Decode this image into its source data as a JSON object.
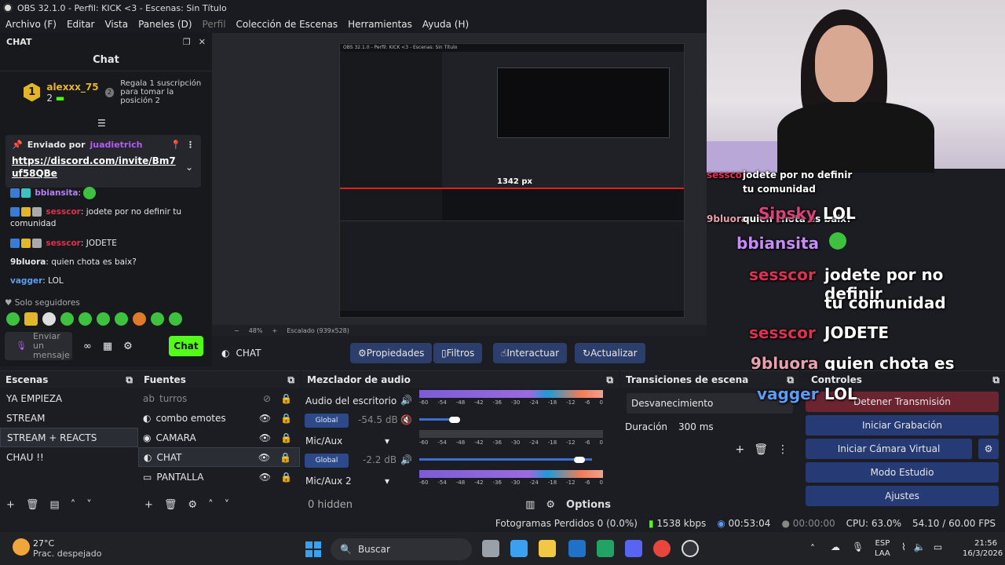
{
  "window": {
    "title": "OBS 32.1.0 - Perfil: KICK <3 - Escenas: Sin Título"
  },
  "menu": [
    "Archivo (F)",
    "Editar",
    "Vista",
    "Paneles (D)",
    "Perfil",
    "Colección de Escenas",
    "Herramientas",
    "Ayuda (H)"
  ],
  "chat_dock": {
    "dock_title": "CHAT",
    "header": "Chat",
    "gift": {
      "rank": "1",
      "user": "alexxx_75",
      "count": "2",
      "position": "2",
      "text": "Regala 1 suscripción para tomar la posición 2"
    },
    "pinned": {
      "label": "Enviado por",
      "user": "juadietrich",
      "link": "https://discord.com/invite/Bm7uf58QBe"
    },
    "messages": [
      {
        "user": "bbiansita",
        "sep": ":",
        "text": "",
        "color": "#b97ff7"
      },
      {
        "user": "sesscor",
        "sep": ":",
        "text": " jodete por no definir tu comunidad",
        "color": "#e0304f"
      },
      {
        "user": "sesscor",
        "sep": ":",
        "text": " JODETE",
        "color": "#e0304f"
      },
      {
        "user": "9bluora",
        "sep": ":",
        "text": " quien chota es baix?",
        "color": "#e6e6e6"
      },
      {
        "user": "vagger",
        "sep": ":",
        "text": " LOL",
        "color": "#5c9cf5"
      }
    ],
    "follow_only": "Solo seguidores",
    "input_placeholder": "Enviar un mensaje",
    "send_button": "Chat"
  },
  "preview": {
    "scale_info": "48%",
    "scale_label": "Escalado (939x528)",
    "mini_px": "1342 px"
  },
  "source_toolbar": {
    "source": "CHAT",
    "buttons": [
      "Propiedades",
      "Filtros",
      "Interactuar",
      "Actualizar"
    ]
  },
  "overlay_chat": [
    {
      "user": "sesscor",
      "text": "jodete por no definir"
    },
    {
      "user": "",
      "text": "tu comunidad"
    },
    {
      "user": "9bluora",
      "text": "quien chota es baix?"
    },
    {
      "user": "Sipsky",
      "text": "LOL"
    },
    {
      "user": "bbiansita",
      "text": ""
    },
    {
      "user": "sesscor",
      "text": "jodete por no definir"
    },
    {
      "user": "",
      "text": "tu comunidad"
    },
    {
      "user": "sesscor",
      "text": "JODETE"
    },
    {
      "user": "9bluora",
      "text": "quien chota es baix?"
    },
    {
      "user": "vagger",
      "text": "LOL"
    }
  ],
  "scenes": {
    "title": "Escenas",
    "items": [
      "YA EMPIEZA",
      "STREAM",
      "STREAM + REACTS",
      "CHAU !!"
    ],
    "selected": 2
  },
  "sources": {
    "title": "Fuentes",
    "items": [
      {
        "name": "turros",
        "icon": "text-icon"
      },
      {
        "name": "combo emotes",
        "icon": "browser-icon"
      },
      {
        "name": "CAMARA",
        "icon": "camera-icon"
      },
      {
        "name": "CHAT",
        "icon": "browser-icon"
      },
      {
        "name": "PANTALLA",
        "icon": "display-icon"
      }
    ]
  },
  "mixer": {
    "title": "Mezclador de audio",
    "channels": [
      {
        "name": "Audio del escritorio",
        "db": "-54.5 dB",
        "button": "Global"
      },
      {
        "name": "Mic/Aux",
        "db": "-2.2 dB",
        "button": "Global"
      },
      {
        "name": "Mic/Aux 2",
        "db": "",
        "button": ""
      }
    ],
    "scale": [
      "-60",
      "-54",
      "-48",
      "-42",
      "-36",
      "-30",
      "-24",
      "-18",
      "-12",
      "-6",
      "0"
    ],
    "hidden": "0 hidden",
    "options": "Options"
  },
  "transitions": {
    "title": "Transiciones de escena",
    "type": "Desvanecimiento",
    "duration_label": "Duración",
    "duration": "300 ms"
  },
  "controls": {
    "title": "Controles",
    "buttons": [
      "Detener Transmisión",
      "Iniciar Grabación",
      "Iniciar Cámara Virtual",
      "Modo Estudio",
      "Ajustes"
    ]
  },
  "status": {
    "dropped": "Fotogramas Perdidos 0 (0.0%)",
    "kbps": "1538 kbps",
    "stream_time": "00:53:04",
    "rec_time": "00:00:00",
    "cpu": "CPU: 63.0%",
    "fps": "54.10 / 60.00 FPS"
  },
  "taskbar": {
    "weather_temp": "27°C",
    "weather_desc": "Prac. despejado",
    "search": "Buscar",
    "lang": "ESP",
    "region": "LAA",
    "time": "21:56",
    "date": "16/3/2026"
  },
  "colors": {
    "kick_green": "#53fc18",
    "obs_blue": "#2c3e6b",
    "stop_red": "#6b2430"
  }
}
